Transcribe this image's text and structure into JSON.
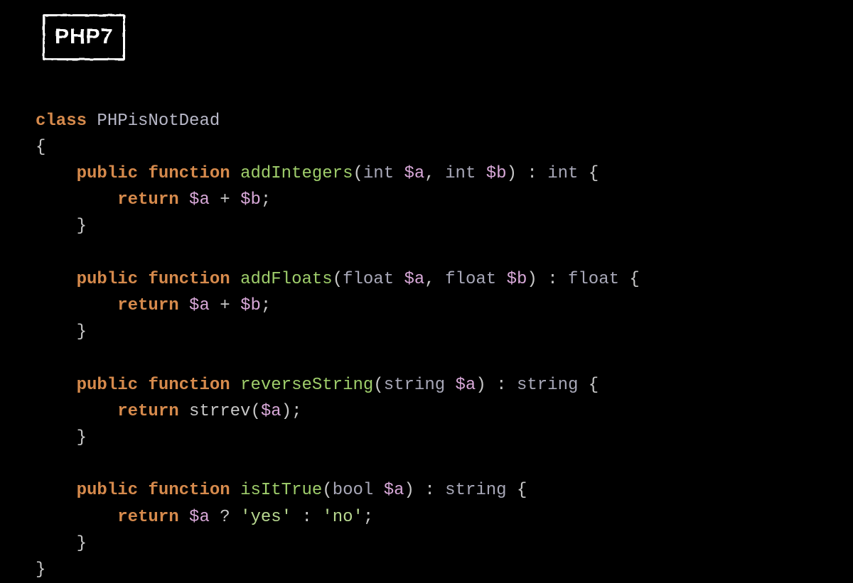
{
  "badge": "PHP7",
  "code": {
    "class_kw": "class",
    "class_name": "PHPisNotDead",
    "open_brace": "{",
    "close_brace": "}",
    "public_kw": "public",
    "function_kw": "function",
    "return_kw": "return",
    "methods": [
      {
        "name": "addIntegers",
        "params": "(int $a, int $b)",
        "ret": "int",
        "body_a": "$a",
        "body_op": "+",
        "body_b": "$b"
      },
      {
        "name": "addFloats",
        "params": "(float $a, float $b)",
        "ret": "float",
        "body_a": "$a",
        "body_op": "+",
        "body_b": "$b"
      },
      {
        "name": "reverseString",
        "params": "(string $a)",
        "ret": "string",
        "call": "strrev",
        "call_arg": "$a"
      },
      {
        "name": "isItTrue",
        "params": "(bool $a)",
        "ret": "string",
        "cond": "$a",
        "yes": "'yes'",
        "no": "'no'"
      }
    ]
  }
}
